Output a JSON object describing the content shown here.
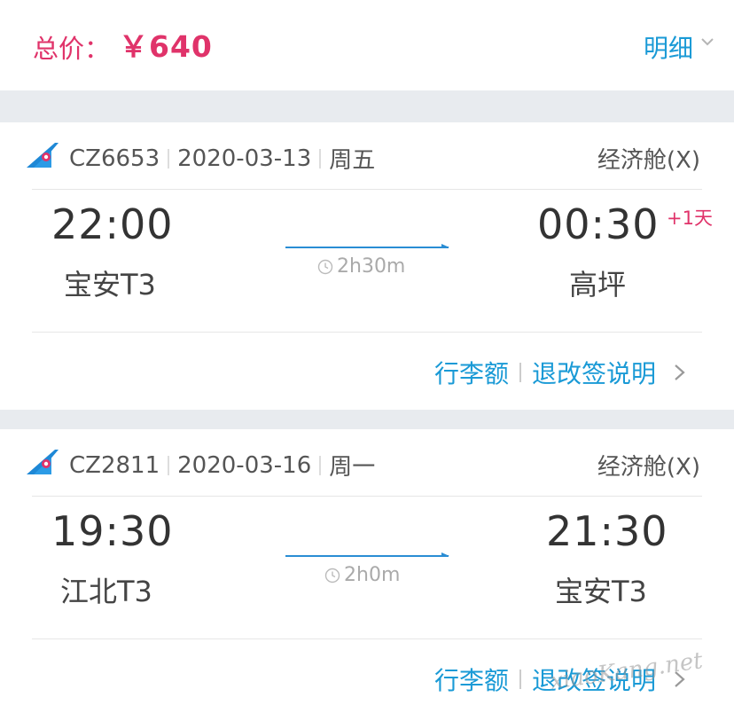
{
  "header": {
    "total_label": "总价：",
    "total_value": "￥640",
    "detail_label": "明细"
  },
  "flights": [
    {
      "flight_no": "CZ6653",
      "date": "2020-03-13",
      "weekday": "周五",
      "cabin": "经济舱(X)",
      "depart_time": "22:00",
      "depart_airport": "宝安T3",
      "arrive_time": "00:30",
      "arrive_airport": "高坪",
      "plus_day": "+1天",
      "duration": "2h30m",
      "baggage_label": "行李额",
      "refund_label": "退改签说明"
    },
    {
      "flight_no": "CZ2811",
      "date": "2020-03-16",
      "weekday": "周一",
      "cabin": "经济舱(X)",
      "depart_time": "19:30",
      "depart_airport": "江北T3",
      "arrive_time": "21:30",
      "arrive_airport": "宝安T3",
      "duration": "2h0m",
      "baggage_label": "行李额",
      "refund_label": "退改签说明"
    }
  ],
  "colors": {
    "price": "#e0336a",
    "link": "#1a9ad6",
    "airline_blue": "#1e88d6",
    "airline_red": "#e0336a"
  },
  "watermark": "xiaoKang.net"
}
